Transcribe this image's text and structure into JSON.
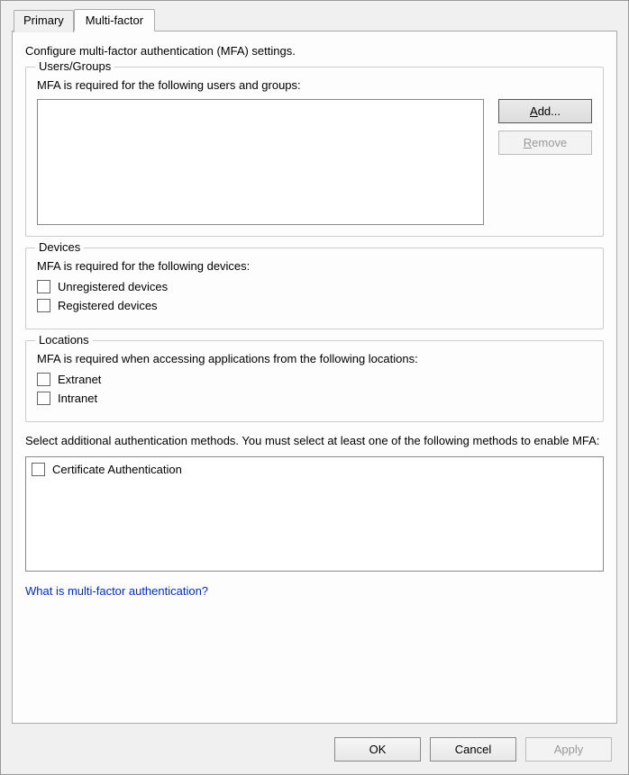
{
  "tabs": {
    "primary": "Primary",
    "multifactor": "Multi-factor"
  },
  "intro": "Configure multi-factor authentication (MFA) settings.",
  "users": {
    "legend": "Users/Groups",
    "sub": "MFA is required for the following users and groups:",
    "add_prefix": "A",
    "add_suffix": "dd...",
    "remove_prefix": "R",
    "remove_suffix": "emove"
  },
  "devices": {
    "legend": "Devices",
    "sub": "MFA is required for the following devices:",
    "unregistered": "Unregistered devices",
    "registered": "Registered devices"
  },
  "locations": {
    "legend": "Locations",
    "sub": "MFA is required when accessing applications from the following locations:",
    "extranet": "Extranet",
    "intranet": "Intranet"
  },
  "methods": {
    "note": "Select additional authentication methods. You must select at least one of the following methods to enable MFA:",
    "cert": "Certificate Authentication"
  },
  "link": "What is multi-factor authentication?",
  "footer": {
    "ok": "OK",
    "cancel": "Cancel",
    "apply": "Apply"
  }
}
